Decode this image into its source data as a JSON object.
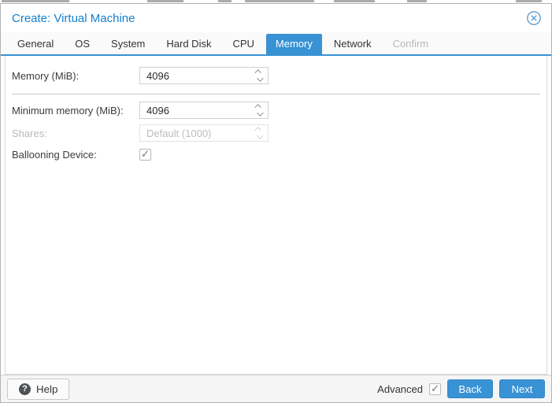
{
  "window": {
    "title": "Create: Virtual Machine"
  },
  "tabs": {
    "items": [
      {
        "label": "General",
        "state": "normal"
      },
      {
        "label": "OS",
        "state": "normal"
      },
      {
        "label": "System",
        "state": "normal"
      },
      {
        "label": "Hard Disk",
        "state": "normal"
      },
      {
        "label": "CPU",
        "state": "normal"
      },
      {
        "label": "Memory",
        "state": "active"
      },
      {
        "label": "Network",
        "state": "normal"
      },
      {
        "label": "Confirm",
        "state": "disabled"
      }
    ]
  },
  "form": {
    "rows": [
      {
        "label": "Memory (MiB):",
        "value": "4096",
        "control": "spinner",
        "enabled": true
      },
      {
        "label": "Minimum memory (MiB):",
        "value": "4096",
        "control": "spinner",
        "enabled": true
      },
      {
        "label": "Shares:",
        "value": "Default (1000)",
        "control": "spinner",
        "enabled": false
      },
      {
        "label": "Ballooning Device:",
        "checked": true,
        "control": "checkbox",
        "enabled": true
      }
    ]
  },
  "footer": {
    "help_label": "Help",
    "help_icon_glyph": "?",
    "advanced_label": "Advanced",
    "advanced_checked": true,
    "back_label": "Back",
    "next_label": "Next"
  },
  "colors": {
    "accent": "#3892d4",
    "title_text": "#157fcc",
    "disabled_text": "#b9b9b9",
    "field_border": "#d0d0d0",
    "checkmark": "#9c9c9c"
  }
}
